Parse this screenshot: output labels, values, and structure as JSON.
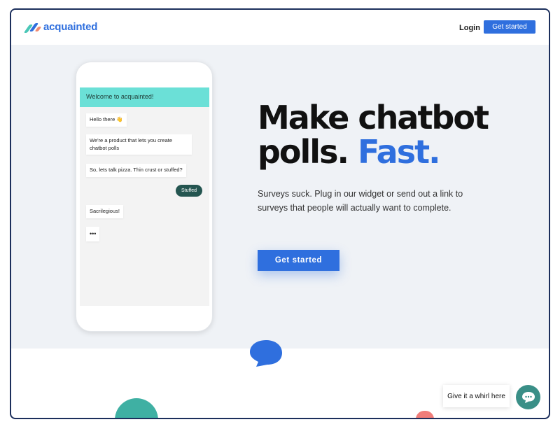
{
  "header": {
    "logo_text": "acquainted",
    "login_label": "Login",
    "get_started_label": "Get started"
  },
  "phone": {
    "chat_title": "Welcome to acquainted!",
    "messages": [
      {
        "from": "bot",
        "text": "Hello there 👋"
      },
      {
        "from": "bot",
        "text": "We're a product that lets you create chatbot polls"
      },
      {
        "from": "bot",
        "text": "So, lets talk pizza. Thin crust or stuffed?"
      },
      {
        "from": "user",
        "text": "Stuffed"
      },
      {
        "from": "bot",
        "text": "Sacrilegious!"
      },
      {
        "from": "bot",
        "text": "•••"
      }
    ]
  },
  "hero": {
    "headline_line1": "Make chatbot",
    "headline_line2_a": "polls.",
    "headline_line2_b": "Fast.",
    "subtext": "Surveys suck. Plug in our widget or send out a link to surveys that people will actually want to complete.",
    "cta_label": "Get started"
  },
  "widget": {
    "prompt_label": "Give it a whirl here"
  },
  "colors": {
    "brand_blue": "#2f6fde",
    "teal": "#6be0d7",
    "dark_teal": "#245550",
    "hero_bg": "#eff2f6"
  }
}
